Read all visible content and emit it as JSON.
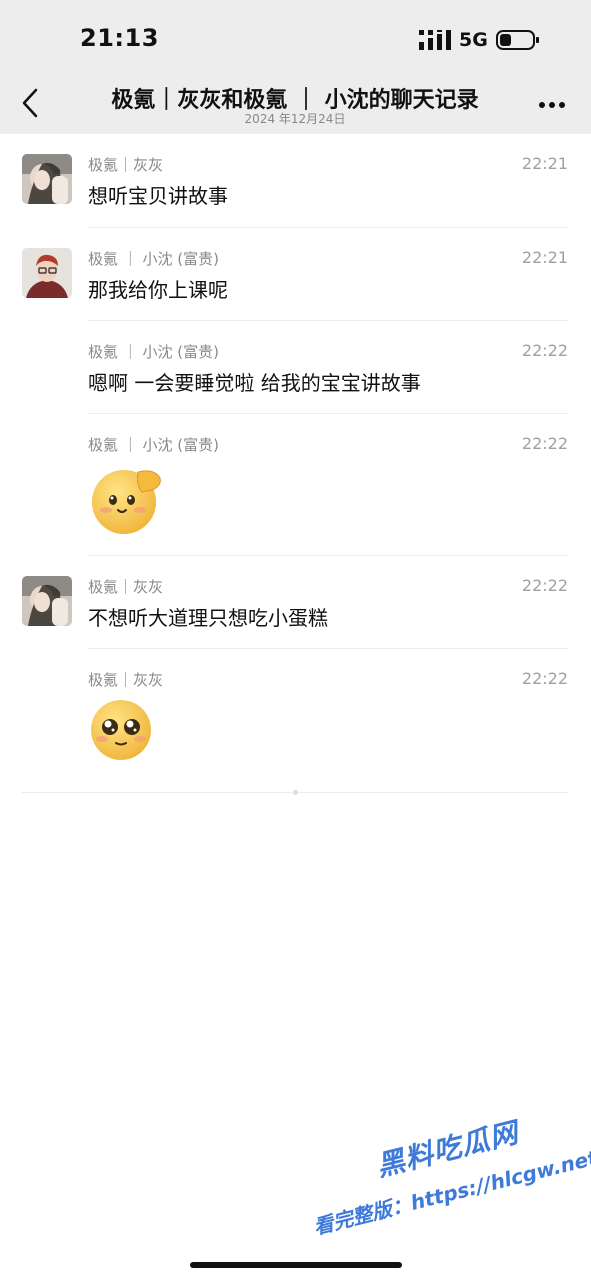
{
  "status_bar": {
    "time": "21:13",
    "network": "5G"
  },
  "nav": {
    "title": "极氪｜灰灰和极氪 ｜ 小沈的聊天记录",
    "subtitle": "2024 年12月24日"
  },
  "messages": [
    {
      "sender": "极氪｜灰灰",
      "time": "22:21",
      "text": "想听宝贝讲故事"
    },
    {
      "sender": "极氪 ｜ 小沈 (富贵)",
      "time": "22:21",
      "text": "那我给你上课呢"
    },
    {
      "sender": "极氪 ｜ 小沈 (富贵)",
      "time": "22:22",
      "text": "嗯啊 一会要睡觉啦 给我的宝宝讲故事"
    },
    {
      "sender": "极氪 ｜ 小沈 (富贵)",
      "time": "22:22",
      "emoji": "salute-emoji"
    },
    {
      "sender": "极氪｜灰灰",
      "time": "22:22",
      "text": "不想听大道理只想吃小蛋糕"
    },
    {
      "sender": "极氪｜灰灰",
      "time": "22:22",
      "emoji": "pleading-emoji"
    }
  ],
  "watermark": {
    "line1": "黑料吃瓜网",
    "line2": "看完整版：https://hlcgw.net"
  },
  "colors": {
    "header_bg": "#ededed",
    "watermark": "#3e7bd9"
  }
}
